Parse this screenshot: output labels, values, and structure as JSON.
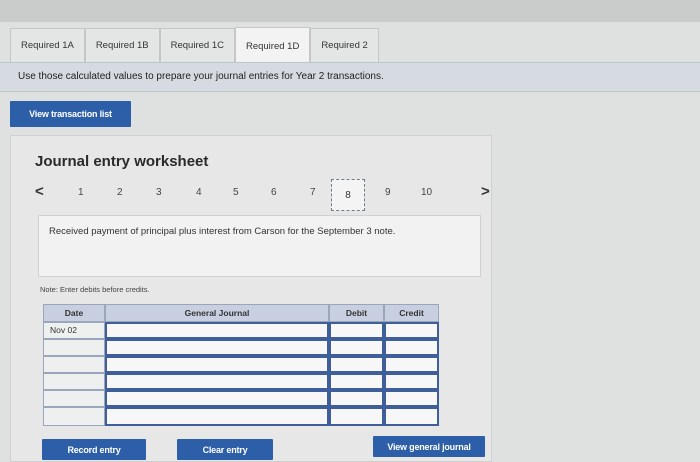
{
  "tabs": [
    "Required 1A",
    "Required 1B",
    "Required 1C",
    "Required 1D",
    "Required 2"
  ],
  "active_tab": "Required 1D",
  "instructions": "Use those calculated values to prepare your journal entries for Year 2 transactions.",
  "view_transaction_list": "View transaction list",
  "worksheet": {
    "title": "Journal entry worksheet",
    "pages": [
      "1",
      "2",
      "3",
      "4",
      "5",
      "6",
      "7",
      "8",
      "9",
      "10"
    ],
    "current_page": "8",
    "prev_arrow": "<",
    "next_arrow": ">",
    "description": "Received payment of principal plus interest from Carson for the September 3 note.",
    "note": "Note: Enter debits before credits.",
    "columns": {
      "date": "Date",
      "journal": "General Journal",
      "debit": "Debit",
      "credit": "Credit"
    },
    "rows": [
      {
        "date": "Nov 02"
      },
      {
        "date": ""
      },
      {
        "date": ""
      },
      {
        "date": ""
      },
      {
        "date": ""
      },
      {
        "date": ""
      }
    ]
  },
  "buttons": {
    "record_entry": "Record entry",
    "clear_entry": "Clear entry",
    "view_general_journal": "View general journal"
  }
}
